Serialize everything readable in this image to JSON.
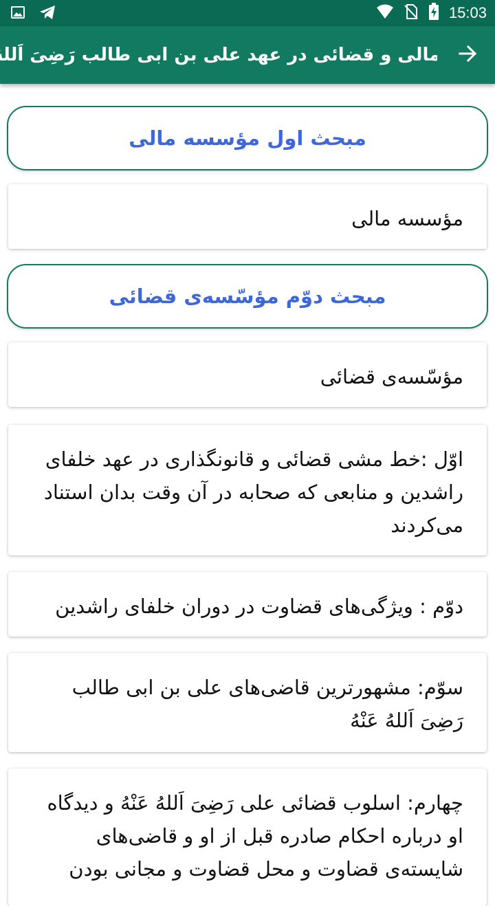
{
  "status_bar": {
    "time": "15:03",
    "icons": [
      "image-icon",
      "telegram-icon",
      "wifi-icon",
      "no-sim-icon",
      "battery-icon"
    ]
  },
  "app_bar": {
    "title": "مؤسسه مالی و قضائی در عهد علی بن ابی طالب رَضِیَ اَللهُ عَنْهُ",
    "back_icon": "arrow-back-icon"
  },
  "sections": [
    {
      "heading": "مبحث اول مؤسسه مالی"
    },
    {
      "item": "مؤسسه مالی"
    },
    {
      "heading": "مبحث دوّم مؤسّسه‌ی قضائی"
    },
    {
      "item": "مؤسّسه‌ی قضائی"
    },
    {
      "item": "اوّل :خط مشی قضائی و قانونگذاری در عهد خلفای راشدین و منابعی که صحابه در آن وقت بدان استناد می‌کردند"
    },
    {
      "item": "دوّم : ویژگی‌های قضاوت در دوران خلفای راشدین"
    },
    {
      "item": "سوّم: مشهورترین قاضی‌های علی بن ابی طالب رَضِیَ اَللهُ عَنْهُ"
    },
    {
      "item": "چهارم: اسلوب قضائی علی رَضِیَ اَللهُ عَنْهُ و دیدگاه او درباره احکام صادره قبل از او و قاضی‌های شایسته‌ی قضاوت و محل قضاوت و مجانی بودن"
    }
  ],
  "colors": {
    "status_bar": "#0b6a53",
    "app_bar": "#127a60",
    "heading_text": "#3e68d8",
    "heading_border": "#127a60"
  }
}
